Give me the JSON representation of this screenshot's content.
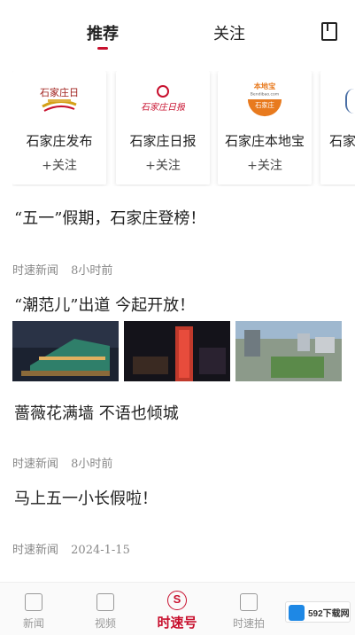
{
  "header": {
    "tabs": [
      {
        "label": "推荐",
        "active": true
      },
      {
        "label": "关注",
        "active": false
      }
    ],
    "bookmark_icon": "bookmark-icon"
  },
  "accounts": [
    {
      "name": "石家庄发布",
      "follow": "+关注",
      "logo_text": "石家庄日"
    },
    {
      "name": "石家庄日报",
      "follow": "+关注",
      "logo_text": "石家庄日报"
    },
    {
      "name": "石家庄本地宝",
      "follow": "+关注",
      "logo_text": "本地宝",
      "logo_sub": "Bendibao.com",
      "logo_badge": "石家庄"
    },
    {
      "name": "石家",
      "follow": "",
      "logo_text": ""
    }
  ],
  "articles": [
    {
      "title": "“五一”假期，石家庄登榜！",
      "source": "时速新闻",
      "time": "8小时前"
    },
    {
      "title": "“潮范儿”出道  今起开放！",
      "source": "",
      "time": ""
    },
    {
      "title": "蔷薇花满墙  不语也倾城",
      "source": "时速新闻",
      "time": "8小时前"
    },
    {
      "title": "马上五一小长假啦！",
      "source": "时速新闻",
      "time": "2024-1-15"
    }
  ],
  "bottom_nav": [
    {
      "label": "新闻",
      "icon": "news-icon",
      "active": false
    },
    {
      "label": "视频",
      "icon": "video-icon",
      "active": false
    },
    {
      "label": "时速号",
      "icon": "speed-icon",
      "active": true
    },
    {
      "label": "时速拍",
      "icon": "camera-icon",
      "active": false
    }
  ],
  "watermark": {
    "text": "592下载网",
    "icon": "site-logo-icon"
  },
  "colors": {
    "accent": "#c8102e",
    "meta": "#888888",
    "text": "#222222"
  }
}
